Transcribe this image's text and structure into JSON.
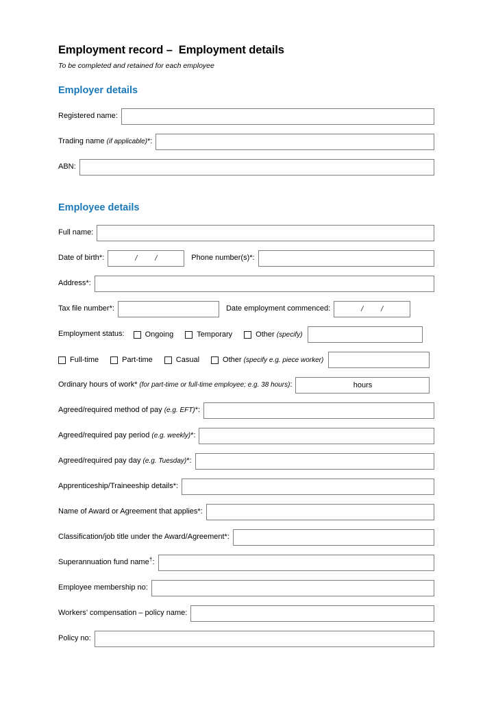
{
  "document": {
    "title": "Employment record –  Employment details",
    "subtitle": "To be completed and retained for each employee"
  },
  "theme": {
    "heading_color": "#1b79b9",
    "box_border_color": "#7f7f7f",
    "text_color": "#000000",
    "page_background": "#ffffff"
  },
  "employer_section": {
    "heading": "Employer details",
    "fields": [
      {
        "label": "Registered name:",
        "value": ""
      },
      {
        "label_main": "Trading name ",
        "label_italic": "(if applicable)",
        "label_tail": "*:",
        "value": ""
      },
      {
        "label": "ABN:",
        "value": ""
      }
    ]
  },
  "employee_section": {
    "heading": "Employee details",
    "full_name": {
      "label": "Full name:",
      "value": ""
    },
    "date_of_birth": {
      "label": "Date of birth*:",
      "value": "",
      "separator1": "/",
      "separator2": "/"
    },
    "phone": {
      "label": "Phone number(s)*:",
      "value": ""
    },
    "address": {
      "label": "Address*:",
      "value": ""
    },
    "tax_file_number": {
      "label": "Tax file number*:",
      "value": ""
    },
    "date_commenced": {
      "label": "Date employment commenced:",
      "value": "",
      "separator1": "/",
      "separator2": "/"
    },
    "employment_status": {
      "label": "Employment status:",
      "options": [
        {
          "label": "Ongoing",
          "checked": false
        },
        {
          "label": "Temporary",
          "checked": false
        }
      ],
      "other_label": "Other ",
      "other_italic": "(specify)",
      "other_value": ""
    },
    "employment_type": {
      "options": [
        {
          "label": "Full-time",
          "checked": false
        },
        {
          "label": "Part-time",
          "checked": false
        },
        {
          "label": "Casual",
          "checked": false
        }
      ],
      "other_label": "Other ",
      "other_italic": "(specify e.g. piece worker)",
      "other_value": ""
    },
    "ordinary_hours": {
      "label_main": "Ordinary hours of work",
      "label_star": "*",
      "label_italic": " (for part-time or full-time employee; e.g. 38 hours)",
      "label_tail": ":",
      "unit": "hours",
      "value": ""
    },
    "method_of_pay": {
      "label_main": "Agreed/required method of pay ",
      "label_italic": "(e.g. EFT)",
      "label_tail": "*:",
      "value": ""
    },
    "pay_period": {
      "label_main": "Agreed/required pay period ",
      "label_italic": "(e.g. weekly)",
      "label_tail": "*:",
      "value": ""
    },
    "pay_day": {
      "label_main": "Agreed/required pay day ",
      "label_italic": "(e.g. Tuesday)",
      "label_tail": "*:",
      "value": ""
    },
    "apprenticeship": {
      "label": "Apprenticeship/Traineeship details*:",
      "value": ""
    },
    "award_name": {
      "label": "Name of Award or Agreement that applies*:",
      "value": ""
    },
    "classification": {
      "label": "Classification/job title under the Award/Agreement*:",
      "value": ""
    },
    "super_fund": {
      "label_main": "Superannuation fund name",
      "label_sup": "†",
      "label_tail": ":",
      "value": ""
    },
    "membership_no": {
      "label": "Employee membership no:",
      "value": ""
    },
    "workers_comp": {
      "label": "Workers’ compensation – policy name:",
      "value": ""
    },
    "policy_no": {
      "label": "Policy no:",
      "value": ""
    }
  }
}
